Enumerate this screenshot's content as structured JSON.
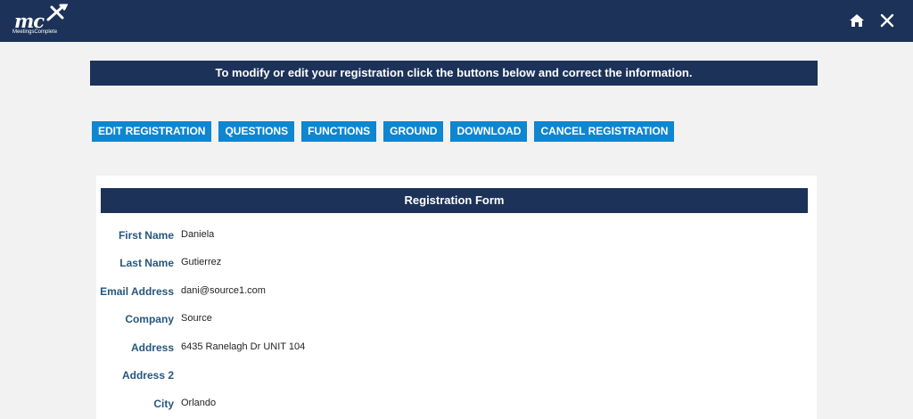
{
  "app": {
    "logo_text": "mc",
    "brand_name": "MeetingsComplete"
  },
  "header": {
    "home_icon": "home-icon",
    "close_icon": "close-icon"
  },
  "notice": "To modify or edit your registration click the buttons below and correct the information.",
  "actions": [
    {
      "label": "EDIT REGISTRATION"
    },
    {
      "label": "QUESTIONS"
    },
    {
      "label": "FUNCTIONS"
    },
    {
      "label": "GROUND"
    },
    {
      "label": "DOWNLOAD"
    },
    {
      "label": "CANCEL REGISTRATION"
    }
  ],
  "form": {
    "title": "Registration Form",
    "fields": [
      {
        "label": "First Name",
        "value": "Daniela"
      },
      {
        "label": "Last Name",
        "value": "Gutierrez"
      },
      {
        "label": "Email Address",
        "value": "dani@source1.com"
      },
      {
        "label": "Company",
        "value": "Source"
      },
      {
        "label": "Address",
        "value": "6435 Ranelagh Dr UNIT 104"
      },
      {
        "label": "Address 2",
        "value": ""
      },
      {
        "label": "City",
        "value": "Orlando"
      }
    ]
  },
  "colors": {
    "navy": "#1c3258",
    "button_blue": "#0e86d0",
    "label_blue": "#26577d",
    "page_bg": "#f2f2f2"
  }
}
